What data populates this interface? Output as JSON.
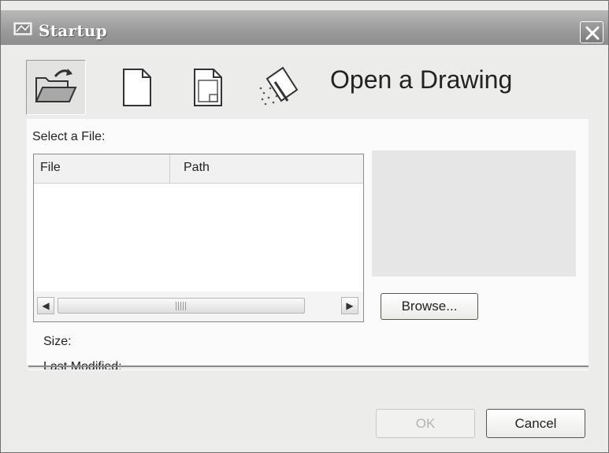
{
  "window": {
    "title": "Startup"
  },
  "toolbar": {
    "modes": [
      {
        "icon": "open-folder-icon",
        "active": true
      },
      {
        "icon": "blank-page-icon",
        "active": false
      },
      {
        "icon": "template-page-icon",
        "active": false
      },
      {
        "icon": "wizard-icon",
        "active": false
      }
    ],
    "heading": "Open a Drawing"
  },
  "file_section": {
    "select_label": "Select a File:",
    "columns": [
      "File",
      "Path"
    ],
    "rows": []
  },
  "preview": {
    "browse_label": "Browse..."
  },
  "details": {
    "size_label": "Size:",
    "modified_label": "Last Modified:"
  },
  "footer": {
    "ok_label": "OK",
    "cancel_label": "Cancel",
    "ok_enabled": false
  }
}
